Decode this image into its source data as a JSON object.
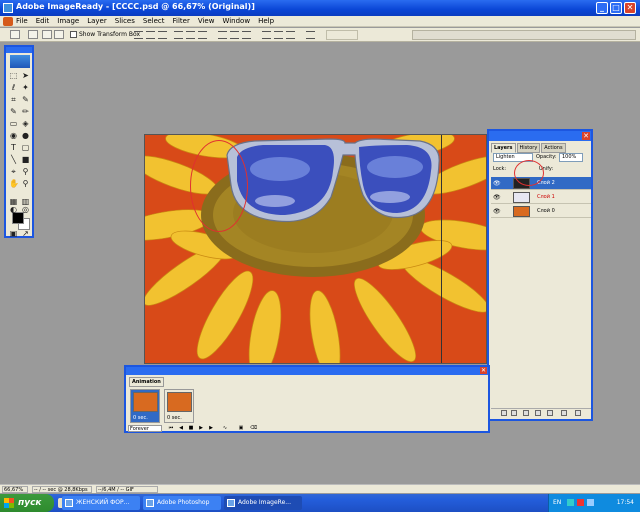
{
  "window": {
    "title": "Adobe ImageReady - [CCCC.psd @ 66,67% (Original)]",
    "min": "_",
    "max": "□",
    "close": "✕"
  },
  "menu": [
    "File",
    "Edit",
    "Image",
    "Layer",
    "Slices",
    "Select",
    "Filter",
    "View",
    "Window",
    "Help"
  ],
  "options": {
    "show_transform_box": "Show Transform Box"
  },
  "layers_panel": {
    "tabs": [
      "Layers",
      "History",
      "Actions"
    ],
    "blend_mode": "Lighten",
    "opacity_label": "Opacity:",
    "opacity": "100%",
    "lock_label": "Lock:",
    "unify_label": "Unify:",
    "layers": [
      {
        "name": "Слой 2",
        "selected": true
      },
      {
        "name": "Слой 1",
        "selected": false
      },
      {
        "name": "Слой 0",
        "selected": false
      }
    ],
    "close": "✕"
  },
  "animation_panel": {
    "tab": "Animation",
    "frames": [
      {
        "delay": "0 sec.",
        "selected": true
      },
      {
        "delay": "0 sec.",
        "selected": false
      }
    ],
    "loop": "Forever",
    "close": "✕"
  },
  "status": {
    "zoom": "66,67%",
    "timing": "-- / -- sec @ 28,8Kbps",
    "size": "--/6,4M / -- GIF"
  },
  "taskbar": {
    "start": "пуск",
    "tasks": [
      {
        "label": "ЖЕНСКИЙ ФОР...",
        "active": false
      },
      {
        "label": "Adobe Photoshop",
        "active": false
      },
      {
        "label": "Adobe ImageRe...",
        "active": true
      }
    ],
    "lang": "EN",
    "clock": "17:54"
  },
  "colors": {
    "xp_blue": "#0a46d6",
    "selection": "#316ac5",
    "canvas_background": "#d84a18",
    "petal": "#f2c230"
  }
}
